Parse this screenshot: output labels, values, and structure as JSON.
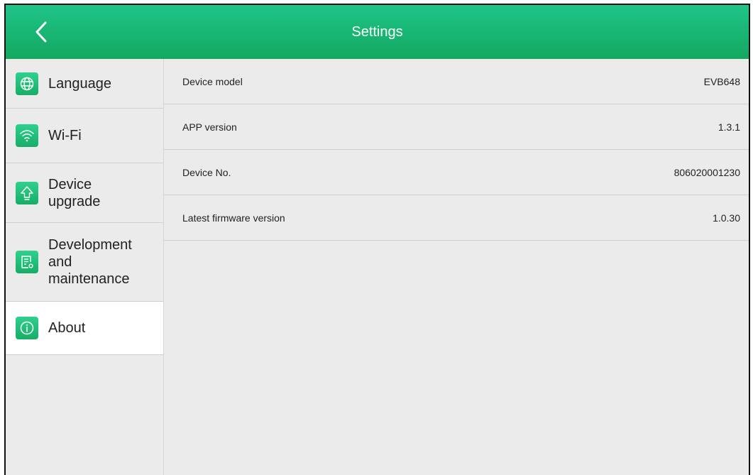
{
  "header": {
    "title": "Settings"
  },
  "sidebar": {
    "items": [
      {
        "label": "Language",
        "icon": "globe-icon"
      },
      {
        "label": "Wi-Fi",
        "icon": "wifi-icon"
      },
      {
        "label": "Device\nupgrade",
        "icon": "upgrade-arrow-icon"
      },
      {
        "label": "Development\nand\nmaintenance",
        "icon": "document-settings-icon"
      },
      {
        "label": "About",
        "icon": "info-icon",
        "active": true
      }
    ]
  },
  "about": {
    "rows": [
      {
        "label": "Device model",
        "value": "EVB648"
      },
      {
        "label": "APP version",
        "value": "1.3.1"
      },
      {
        "label": "Device No.",
        "value": "806020001230"
      },
      {
        "label": "Latest firmware version",
        "value": "1.0.30"
      }
    ]
  },
  "colors": {
    "accent": "#13a85f",
    "header_top": "#1fc48a",
    "background": "#ebebeb",
    "active_item": "#ffffff"
  }
}
